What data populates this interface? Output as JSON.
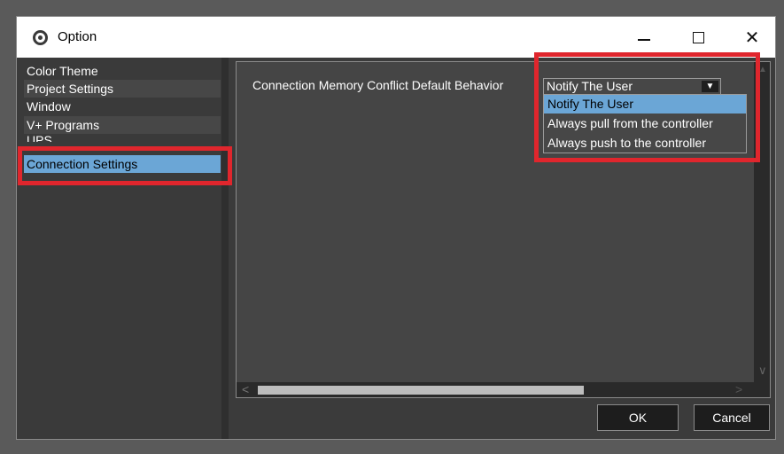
{
  "window": {
    "title": "Option",
    "controls": {
      "minimize": "—",
      "maximize": "",
      "close": "✕"
    }
  },
  "sidebar": {
    "items": [
      {
        "label": "Color Theme"
      },
      {
        "label": "Project Settings"
      },
      {
        "label": "Window"
      },
      {
        "label": "V+ Programs"
      },
      {
        "label": "UPS"
      },
      {
        "label": "Connection Settings",
        "selected": true
      }
    ]
  },
  "content": {
    "setting_label": "Connection Memory Conflict Default Behavior",
    "select": {
      "value": "Notify The User",
      "arrow": "▼",
      "options": [
        {
          "label": "Notify The User",
          "highlighted": true
        },
        {
          "label": "Always pull from the controller"
        },
        {
          "label": "Always push to the controller"
        }
      ]
    },
    "scrollbars": {
      "up": "▲",
      "down": "∨",
      "left": "<",
      "right": ">"
    }
  },
  "footer": {
    "ok_label": "OK",
    "cancel_label": "Cancel"
  },
  "colors": {
    "accent": "#6ba6d6",
    "highlight_box": "#e0262d",
    "panel": "#454545"
  }
}
